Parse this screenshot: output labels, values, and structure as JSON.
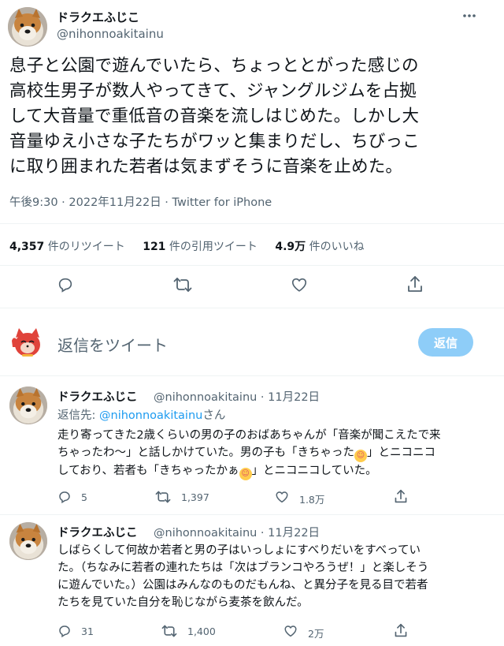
{
  "main_tweet": {
    "author_name": "ドラクエふじこ",
    "author_handle": "@nihonnoakitainu",
    "text_lines": [
      "息子と公園で遊んでいたら、ちょっととがった感じの",
      "高校生男子が数人やってきて、ジャングルジムを占拠",
      "して大音量で重低音の音楽を流しはじめた。しかし大",
      "音量ゆえ小さな子たちがワッと集まりだし、ちびっこ",
      "に取り囲まれた若者は気まずそうに音楽を止めた。"
    ],
    "timestamp": "午後9:30 · 2022年11月22日 · Twitter for iPhone",
    "stats": {
      "retweets_num": "4,357",
      "retweets_label": "件のリツイート",
      "quotes_num": "121",
      "quotes_label": "件の引用ツイート",
      "likes_num": "4.9万",
      "likes_label": "件のいいね"
    }
  },
  "composer": {
    "placeholder": "返信をツイート",
    "reply_button": "返信"
  },
  "replies": [
    {
      "author_name": "ドラクエふじこ",
      "handle_date": "@nihonnoakitainu · 11月22日",
      "replying_prefix": "返信先: ",
      "replying_handle": "@nihonnoakitainu",
      "replying_suffix": "さん",
      "lines": [
        "走り寄ってきた2歳くらいの男の子のおばあちゃんが「音楽が聞こえたで来",
        "ちゃったわ〜」と話しかけていた。男の子も「きちゃった",
        "」とニコニコ",
        "しており、若者も「きちゃったかぁ",
        "」とニコニコしていた。"
      ],
      "emoji": "☺",
      "counts": {
        "reply": "5",
        "retweet": "1,397",
        "like": "1.8万"
      }
    },
    {
      "author_name": "ドラクエふじこ",
      "handle_date": "@nihonnoakitainu · 11月22日",
      "lines": [
        "しばらくして何故か若者と男の子はいっしょにすべりだいをすべってい",
        "た。（ちなみに若者の連れたちは「次はブランコやろうぜ！」と楽しそう",
        "に遊んでいた。）公園はみんなのものだもんね、と異分子を見る目で若者",
        "たちを見ていた自分を恥じながら麦茶を飲んだ。"
      ],
      "counts": {
        "reply": "31",
        "retweet": "1,400",
        "like": "2万"
      }
    }
  ],
  "icons": {
    "more": "more-dots-icon",
    "reply": "reply-bubble-icon",
    "retweet": "retweet-icon",
    "like": "heart-icon",
    "share": "share-icon",
    "avatar": "shiba-dog-avatar",
    "composer_avatar": "lucky-cat-avatar"
  },
  "colors": {
    "text": "#0f1419",
    "secondary": "#536471",
    "link": "#1d9bf0",
    "reply_button_disabled": "#8ecdf8",
    "divider": "#eff3f4"
  }
}
